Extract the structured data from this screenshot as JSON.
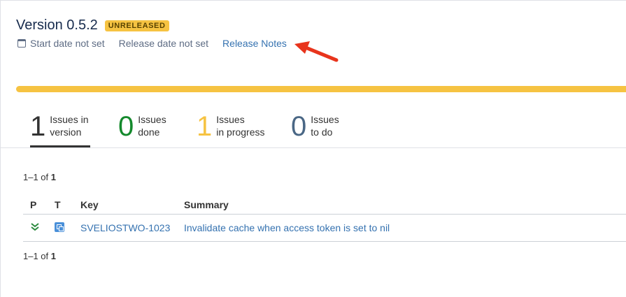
{
  "version": {
    "title": "Version 0.5.2",
    "status_badge": "UNRELEASED",
    "start_date": "Start date not set",
    "release_date": "Release date not set",
    "release_notes_link": "Release Notes"
  },
  "progress": {
    "in_progress_fraction": 1.0,
    "color": "#f6c342"
  },
  "stats": [
    {
      "count": "1",
      "label_line1": "Issues in",
      "label_line2": "version",
      "color": "#333333"
    },
    {
      "count": "0",
      "label_line1": "Issues",
      "label_line2": "done",
      "color": "#14892c"
    },
    {
      "count": "1",
      "label_line1": "Issues",
      "label_line2": "in progress",
      "color": "#f6c342"
    },
    {
      "count": "0",
      "label_line1": "Issues",
      "label_line2": "to do",
      "color": "#4a6785"
    }
  ],
  "pagination": {
    "top": "1–1 of",
    "top_total": "1",
    "bottom": "1–1 of",
    "bottom_total": "1"
  },
  "table": {
    "headers": {
      "p": "P",
      "t": "T",
      "key": "Key",
      "summary": "Summary"
    },
    "rows": [
      {
        "priority_icon": "chevron-double-down-icon",
        "type_icon": "subtask-icon",
        "key": "SVELIOSTWO-1023",
        "summary": "Invalidate cache when access token is set to nil"
      }
    ]
  },
  "colors": {
    "accent_link": "#3572b0",
    "annotation_arrow": "#e8341c"
  }
}
